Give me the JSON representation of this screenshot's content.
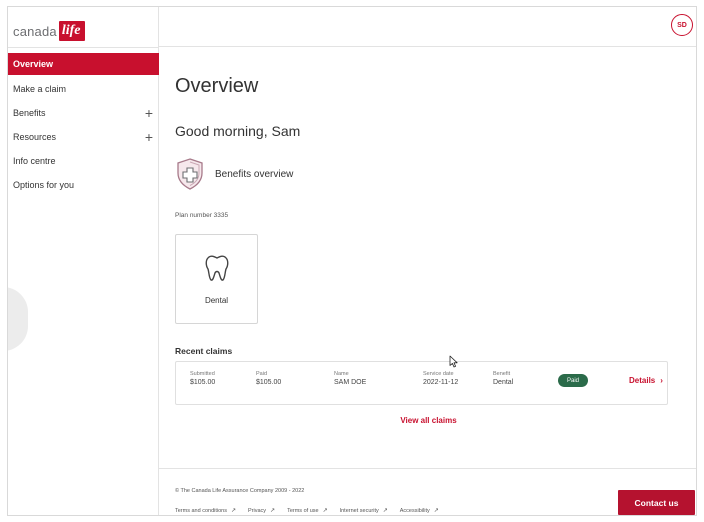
{
  "brand": {
    "name_text": "canada",
    "name_mark": "life",
    "accent_color": "#c8102e"
  },
  "user": {
    "initials": "SD"
  },
  "sidebar": {
    "items": [
      {
        "label": "Overview",
        "active": true,
        "expand_icon": ""
      },
      {
        "label": "Make a claim",
        "active": false,
        "expand_icon": ""
      },
      {
        "label": "Benefits",
        "active": false,
        "expand_icon": "+"
      },
      {
        "label": "Resources",
        "active": false,
        "expand_icon": "+"
      },
      {
        "label": "Info centre",
        "active": false,
        "expand_icon": ""
      },
      {
        "label": "Options for you",
        "active": false,
        "expand_icon": ""
      }
    ]
  },
  "main": {
    "title": "Overview",
    "greeting": "Good morning, Sam",
    "benefits_overview_label": "Benefits overview",
    "benefits_icon": "shield-plus-icon",
    "plan_number": "Plan number 3335",
    "benefit_cards": [
      {
        "label": "Dental",
        "icon": "tooth-icon"
      }
    ],
    "recent_claims": {
      "title": "Recent claims",
      "claims": [
        {
          "submitted_label": "Submitted",
          "submitted_value": "$105.00",
          "paid_label": "Paid",
          "paid_value": "$105.00",
          "name_label": "Name",
          "name_value": "SAM DOE",
          "service_date_label": "Service date",
          "service_date_value": "2022-11-12",
          "benefit_label": "Benefit",
          "benefit_value": "Dental",
          "status": "Paid",
          "status_color": "#2b6b4a",
          "details_label": "Details",
          "details_icon": "chevron-right-icon"
        }
      ],
      "view_all_label": "View all claims"
    }
  },
  "footer": {
    "copyright": "© The Canada Life Assurance Company 2009 - 2022",
    "links": [
      {
        "label": "Terms and conditions",
        "icon": "↗"
      },
      {
        "label": "Privacy",
        "icon": "↗"
      },
      {
        "label": "Terms of use",
        "icon": "↗"
      },
      {
        "label": "Internet security",
        "icon": "↗"
      },
      {
        "label": "Accessibility",
        "icon": "↗"
      }
    ],
    "contact_label": "Contact us"
  }
}
